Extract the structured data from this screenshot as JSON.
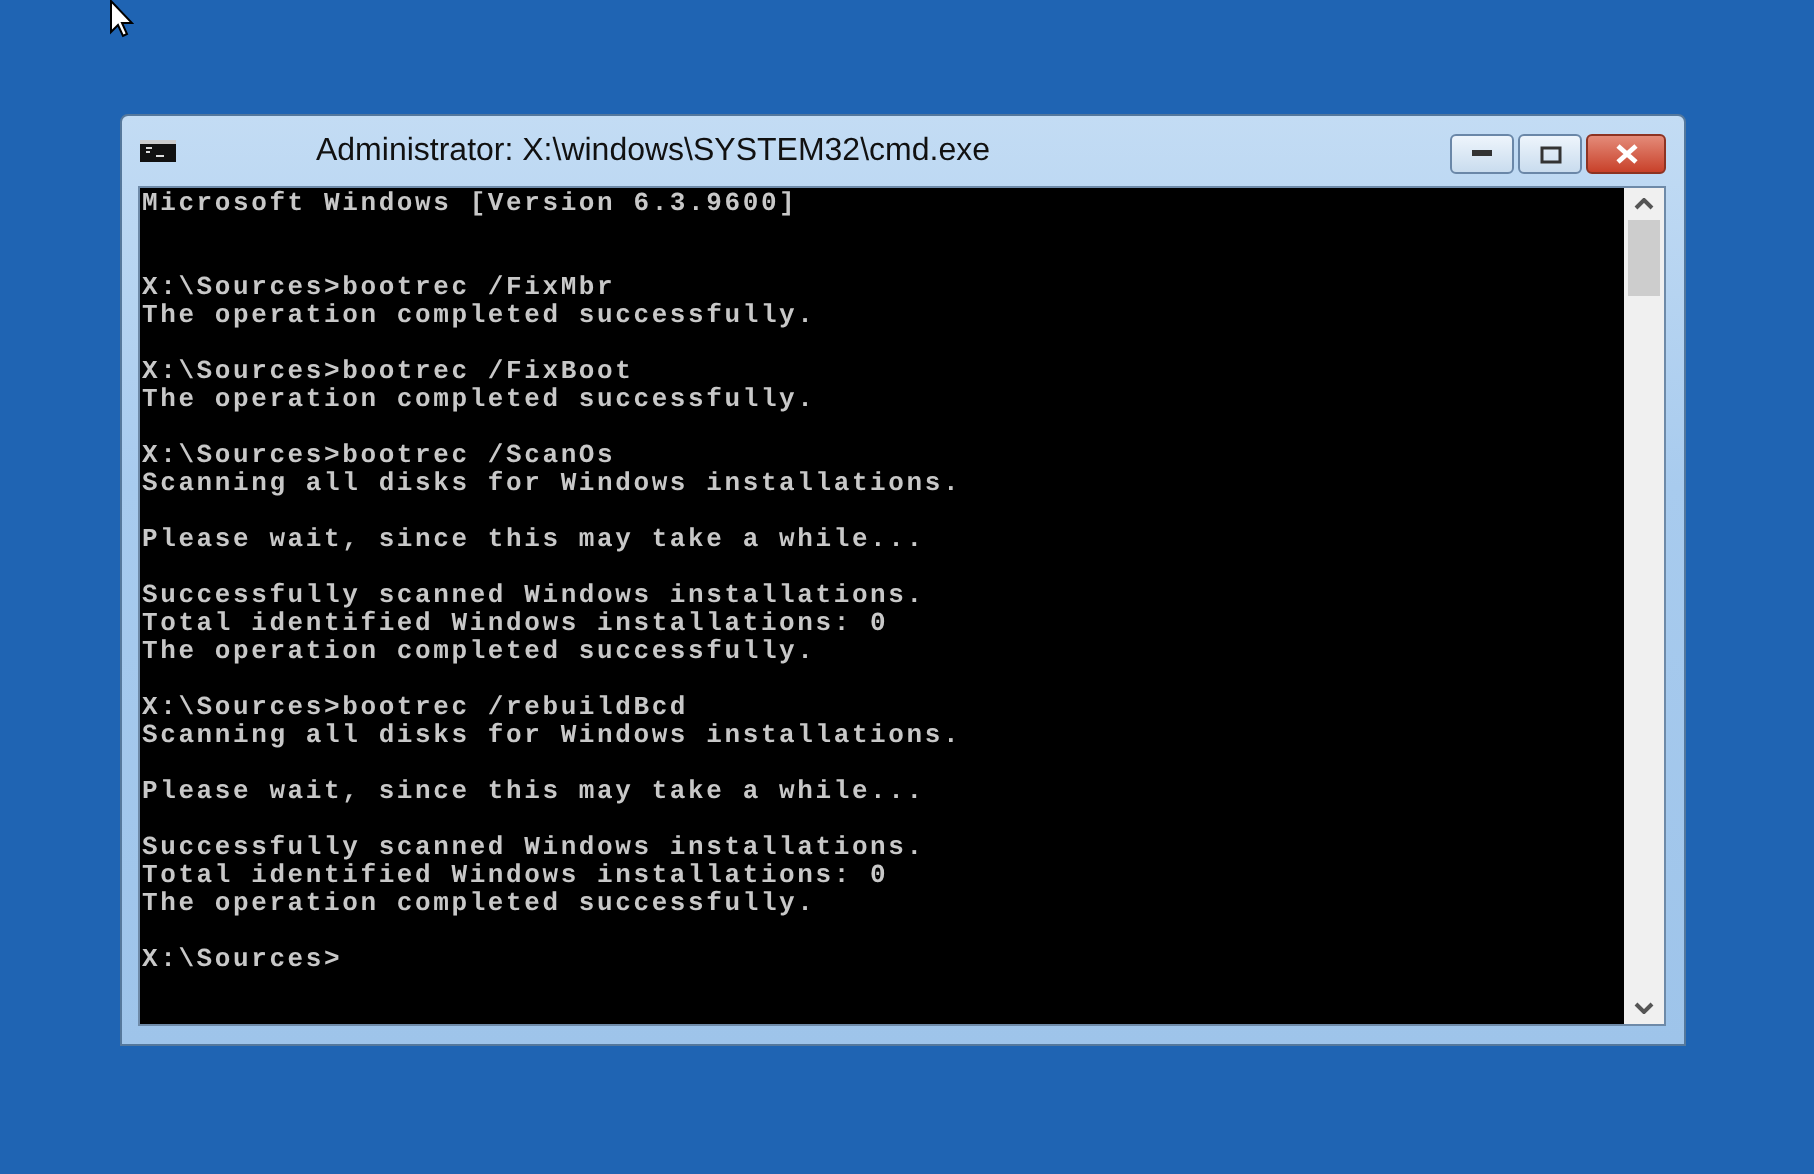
{
  "window": {
    "title": "Administrator: X:\\windows\\SYSTEM32\\cmd.exe"
  },
  "console": {
    "blocks": [
      {
        "kind": "banner",
        "lines": [
          "Microsoft Windows [Version 6.3.9600]"
        ]
      },
      {
        "kind": "output",
        "lines": [
          "X:\\Sources>bootrec /FixMbr",
          "The operation completed successfully."
        ]
      },
      {
        "kind": "output",
        "lines": [
          "X:\\Sources>bootrec /FixBoot",
          "The operation completed successfully."
        ]
      },
      {
        "kind": "output",
        "lines": [
          "X:\\Sources>bootrec /ScanOs",
          "Scanning all disks for Windows installations."
        ]
      },
      {
        "kind": "output",
        "lines": [
          "Please wait, since this may take a while..."
        ]
      },
      {
        "kind": "output",
        "lines": [
          "Successfully scanned Windows installations.",
          "Total identified Windows installations: 0",
          "The operation completed successfully."
        ]
      },
      {
        "kind": "output",
        "lines": [
          "X:\\Sources>bootrec /rebuildBcd",
          "Scanning all disks for Windows installations."
        ]
      },
      {
        "kind": "output",
        "lines": [
          "Please wait, since this may take a while..."
        ]
      },
      {
        "kind": "output",
        "lines": [
          "Successfully scanned Windows installations.",
          "Total identified Windows installations: 0",
          "The operation completed successfully."
        ]
      },
      {
        "kind": "output",
        "lines": [
          "X:\\Sources>"
        ]
      }
    ]
  }
}
